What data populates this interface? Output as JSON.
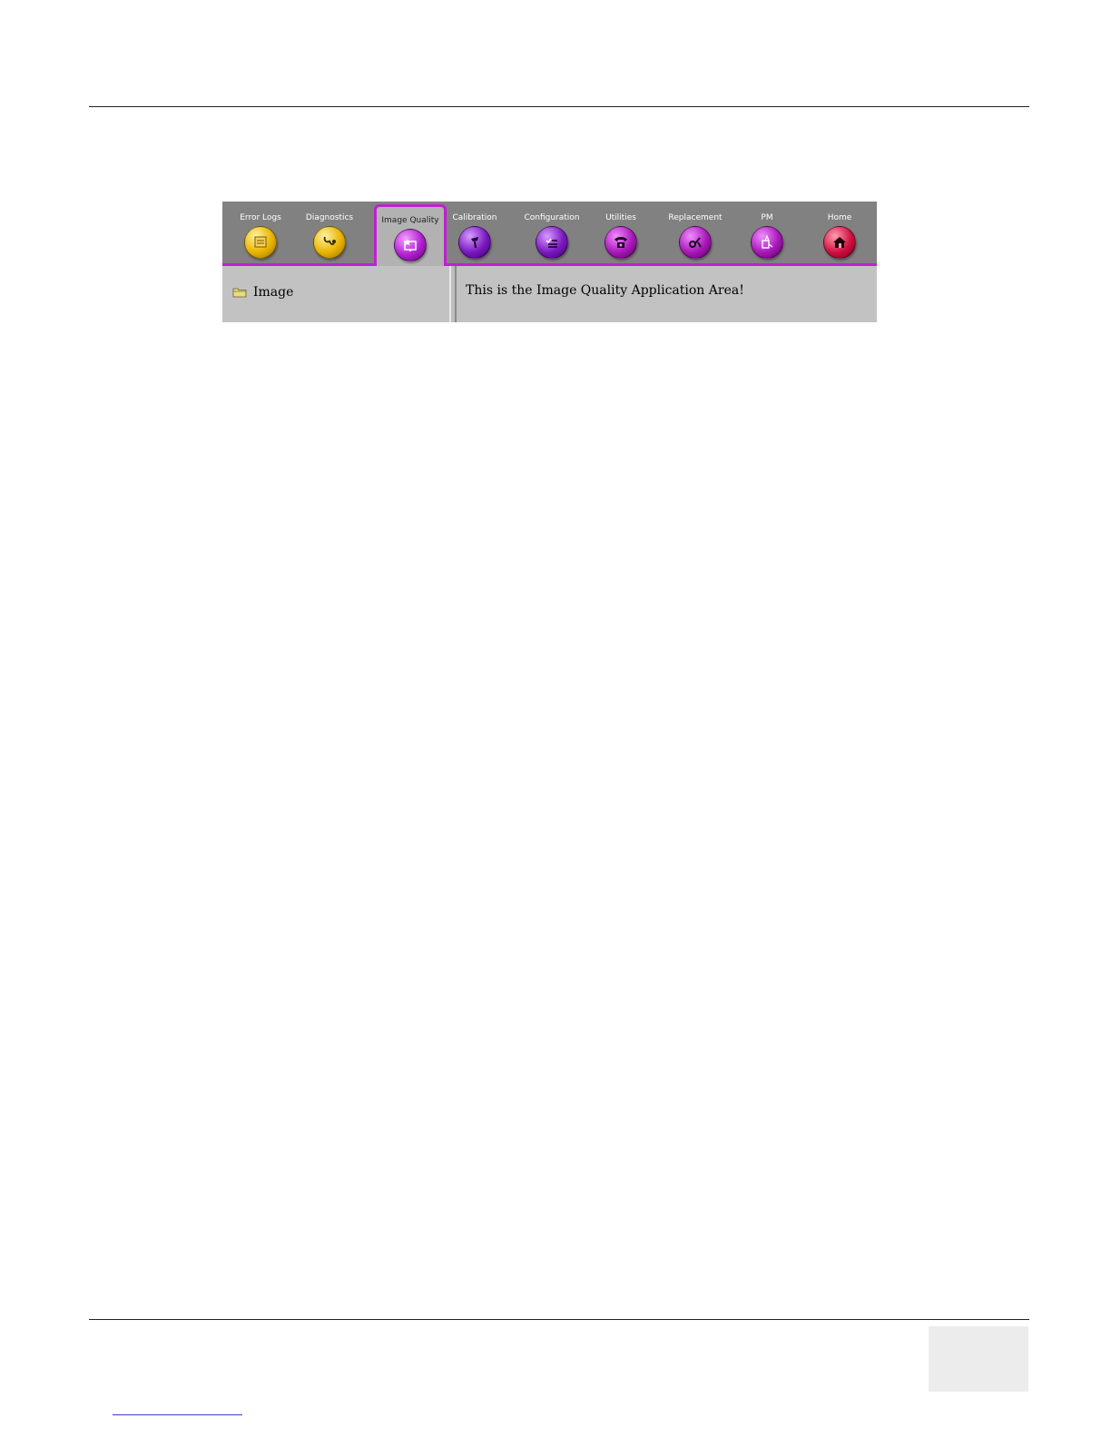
{
  "toolbar": {
    "tabs": [
      {
        "id": "error-logs",
        "label": "Error Logs",
        "icon": "log-sheet-icon",
        "color": "#e8b400",
        "active": false
      },
      {
        "id": "diagnostics",
        "label": "Diagnostics",
        "icon": "stethoscope-icon",
        "color": "#e8b400",
        "active": false
      },
      {
        "id": "image-quality",
        "label": "Image Quality",
        "icon": "monitor-star-icon",
        "color": "#a020c0",
        "active": true
      },
      {
        "id": "calibration",
        "label": "Calibration",
        "icon": "probe-icon",
        "color": "#7a18c0",
        "active": false
      },
      {
        "id": "configuration",
        "label": "Configuration",
        "icon": "checklist-icon",
        "color": "#7a18c0",
        "active": false
      },
      {
        "id": "utilities",
        "label": "Utilities",
        "icon": "phone-icon",
        "color": "#a818b8",
        "active": false
      },
      {
        "id": "replacement",
        "label": "Replacement",
        "icon": "wrench-icon",
        "color": "#a818b8",
        "active": false
      },
      {
        "id": "pm",
        "label": "PM",
        "icon": "oil-can-icon",
        "color": "#a818b8",
        "active": false
      },
      {
        "id": "home",
        "label": "Home",
        "icon": "house-icon",
        "color": "#d01040",
        "active": false
      }
    ]
  },
  "left_pane": {
    "item_label": "Image",
    "item_icon": "folder-icon"
  },
  "right_pane": {
    "text": "This is the Image Quality Application Area!"
  },
  "colors": {
    "accent": "#c020d0",
    "toolbar": "#818181",
    "pane": "#c2c2c2"
  }
}
